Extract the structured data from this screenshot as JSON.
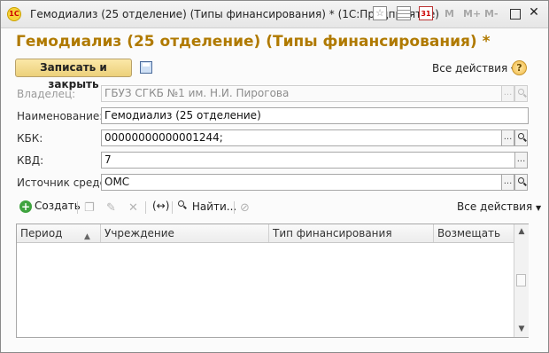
{
  "window": {
    "title": "Гемодиализ (25 отделение) (Типы финансирования) * (1С:Предприятие)",
    "logo": "1С",
    "memory_buttons": [
      "M",
      "M+",
      "M-"
    ],
    "calendar_day": "31"
  },
  "form": {
    "title": "Гемодиализ (25 отделение) (Типы финансирования) *"
  },
  "toolbar": {
    "save_close_label": "Записать и закрыть",
    "all_actions_label": "Все действия",
    "help_label": "?"
  },
  "fields": {
    "owner": {
      "label": "Владелец:",
      "value": "ГБУЗ СГКБ №1 им. Н.И. Пирогова",
      "enabled": false
    },
    "name": {
      "label": "Наименование:",
      "value": "Гемодиализ (25 отделение)"
    },
    "kbk": {
      "label": "КБК:",
      "value": "00000000000001244;"
    },
    "kvd": {
      "label": "КВД:",
      "value": "7"
    },
    "source": {
      "label": "Источник средств:",
      "value": "ОМС"
    }
  },
  "list_toolbar": {
    "create_label": "Создать",
    "find_label": "Найти...",
    "all_actions_label": "Все действия",
    "link_label": "(↔)"
  },
  "table": {
    "columns": [
      "Период",
      "Учреждение",
      "Тип финансирования",
      "Возмещать"
    ],
    "rows": []
  },
  "colors": {
    "title": "#b07a00",
    "primary_button": "#ecd07a",
    "create_icon": "#3fa33f"
  }
}
